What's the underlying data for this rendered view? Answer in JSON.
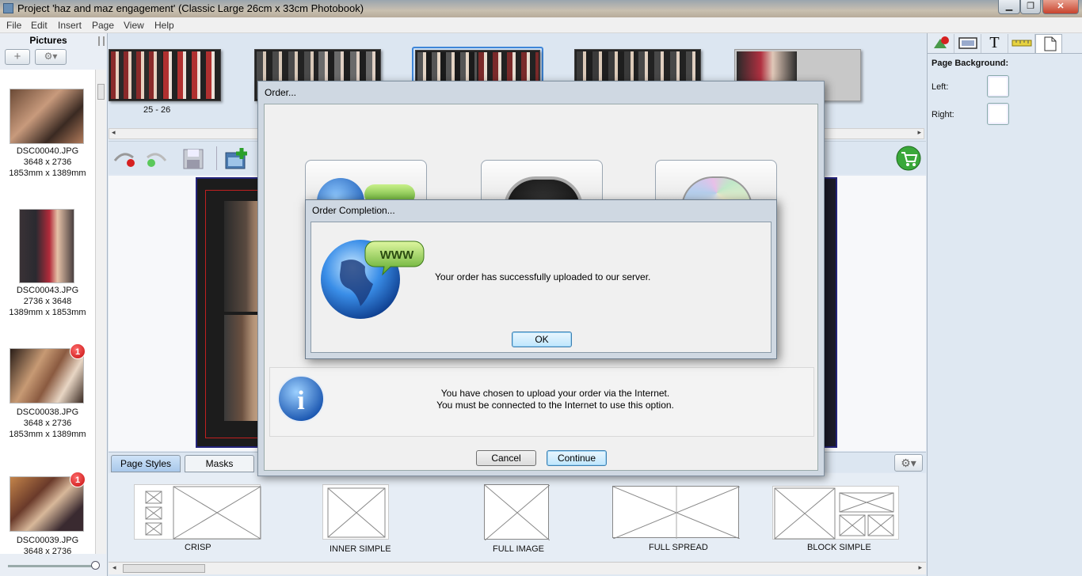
{
  "window": {
    "title": "Project 'haz and maz engagement' (Classic Large 26cm x 33cm Photobook)",
    "minimize": "▁",
    "maximize": "❐",
    "close": "✕"
  },
  "menu": [
    "File",
    "Edit",
    "Insert",
    "Page",
    "View",
    "Help"
  ],
  "pictures_panel": {
    "title": "Pictures",
    "add_label": "+",
    "gear_label": "⚙▾",
    "items": [
      {
        "name": "DSC00040.JPG",
        "pixels": "3648 x 2736",
        "size_mm": "1853mm x 1389mm",
        "badge": ""
      },
      {
        "name": "DSC00043.JPG",
        "pixels": "2736 x 3648",
        "size_mm": "1389mm x 1853mm",
        "badge": ""
      },
      {
        "name": "DSC00038.JPG",
        "pixels": "3648 x 2736",
        "size_mm": "1853mm x 1389mm",
        "badge": "1"
      },
      {
        "name": "DSC00039.JPG",
        "pixels": "3648 x 2736",
        "size_mm": "",
        "badge": "1"
      }
    ]
  },
  "spread_strip": {
    "page_label": "25 - 26"
  },
  "tabs": {
    "page_styles": "Page Styles",
    "masks": "Masks",
    "gear": "⚙▾"
  },
  "page_styles": [
    "CRISP",
    "INNER SIMPLE",
    "FULL IMAGE",
    "FULL SPREAD",
    "BLOCK SIMPLE"
  ],
  "right_panel": {
    "tab_text_icon": "T",
    "heading": "Page Background:",
    "left_label": "Left:",
    "right_label": "Right:"
  },
  "order_dialog": {
    "title": "Order...",
    "info_line1": "You have chosen to upload your order via the Internet.",
    "info_line2": "You must be connected to the Internet to use this option.",
    "cancel_label": "Cancel",
    "continue_label": "Continue"
  },
  "completion_dialog": {
    "title": "Order Completion...",
    "www_label": "WWW",
    "message": "Your order has successfully uploaded to our server.",
    "ok_label": "OK"
  },
  "icons": {
    "info_glyph": "i",
    "cart_glyph": "🛒"
  }
}
